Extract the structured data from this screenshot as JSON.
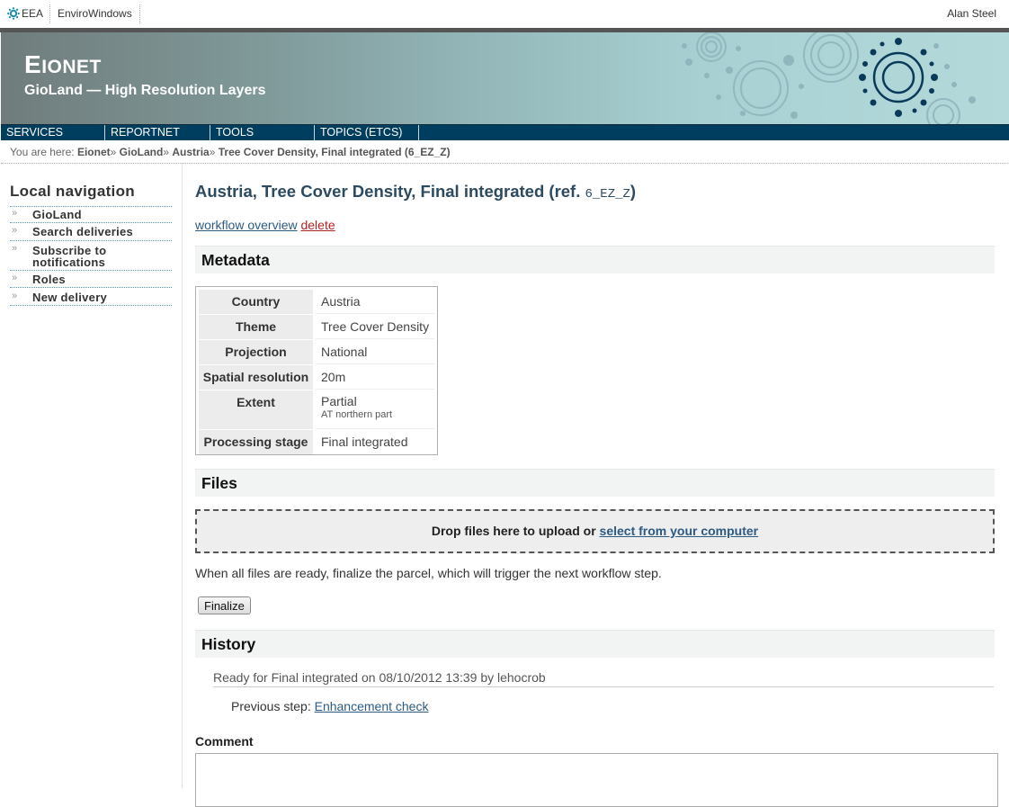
{
  "topbar": {
    "eea_label": "EEA",
    "envirowindows_label": "EnviroWindows",
    "user_name": "Alan Steel"
  },
  "header": {
    "site_title_first": "E",
    "site_title_rest": "IONET",
    "site_subtitle": "GioLand — High Resolution Layers"
  },
  "mainnav": {
    "items": [
      {
        "label": "SERVICES"
      },
      {
        "label": "REPORTNET"
      },
      {
        "label": "TOOLS"
      },
      {
        "label": "TOPICS (ETCS)"
      }
    ]
  },
  "breadcrumb": {
    "prefix": "You are here:",
    "items": [
      "Eionet",
      "GioLand",
      "Austria",
      "Tree Cover Density, Final integrated (6_EZ_Z)"
    ],
    "separator": "»"
  },
  "localnav": {
    "title": "Local navigation",
    "items": [
      {
        "label": "GioLand"
      },
      {
        "label": "Search deliveries"
      },
      {
        "label": "Subscribe to notifications"
      },
      {
        "label": "Roles"
      },
      {
        "label": "New delivery"
      }
    ]
  },
  "page": {
    "title_text": "Austria, Tree Cover Density, Final integrated (ref.",
    "title_ref": "6_EZ_Z",
    "title_close": ")",
    "workflow_overview_link": "workflow overview",
    "delete_link": "delete"
  },
  "metadata": {
    "heading": "Metadata",
    "rows": [
      {
        "key": "Country",
        "value": "Austria",
        "sub": ""
      },
      {
        "key": "Theme",
        "value": "Tree Cover Density",
        "sub": ""
      },
      {
        "key": "Projection",
        "value": "National",
        "sub": ""
      },
      {
        "key": "Spatial resolution",
        "value": "20m",
        "sub": ""
      },
      {
        "key": "Extent",
        "value": "Partial",
        "sub": "AT northern part"
      },
      {
        "key": "Processing stage",
        "value": "Final integrated",
        "sub": ""
      }
    ]
  },
  "files": {
    "heading": "Files",
    "drop_text": "Drop files here to upload or",
    "select_link": "select from your computer",
    "finalize_note": "When all files are ready, finalize the parcel, which will trigger the next workflow step.",
    "finalize_button": "Finalize"
  },
  "history": {
    "heading": "History",
    "entry": "Ready for Final integrated on 08/10/2012 13:39 by lehocrob",
    "previous_step_label": "Previous step:",
    "previous_step_link": "Enhancement check"
  },
  "comment": {
    "label": "Comment"
  },
  "colors": {
    "nav_background": "#003e5f",
    "title_color": "#2c4a60",
    "link_color": "#2c5a80",
    "delete_color": "#b22222"
  }
}
